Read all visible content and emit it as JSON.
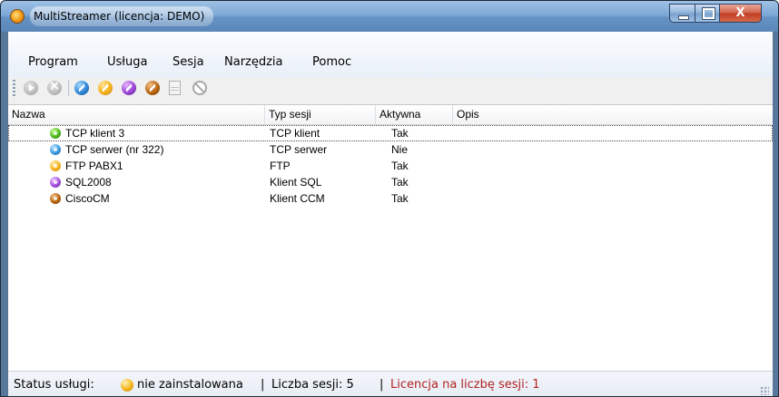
{
  "window": {
    "title": "MultiStreamer (licencja: DEMO)",
    "close_glyph": "X"
  },
  "menu": {
    "items": [
      "Program",
      "Usługa",
      "Sesja",
      "Narzędzia",
      "Pomoc"
    ]
  },
  "toolbar": {
    "icons": [
      "play-icon",
      "stop-icon",
      "blue-session-icon",
      "orange-session-icon",
      "purple-session-icon",
      "brown-session-icon",
      "document-icon",
      "disable-icon"
    ]
  },
  "table": {
    "columns": [
      "Nazwa",
      "Typ sesji",
      "Aktywna",
      "Opis"
    ],
    "rows": [
      {
        "name": "TCP klient 3",
        "type": "TCP klient",
        "active": "Tak",
        "desc": "",
        "icon": "green"
      },
      {
        "name": "TCP serwer (nr 322)",
        "type": "TCP serwer",
        "active": "Nie",
        "desc": "",
        "icon": "blue"
      },
      {
        "name": "FTP PABX1",
        "type": "FTP",
        "active": "Tak",
        "desc": "",
        "icon": "orange"
      },
      {
        "name": "SQL2008",
        "type": "Klient SQL",
        "active": "Tak",
        "desc": "",
        "icon": "purple"
      },
      {
        "name": "CiscoCM",
        "type": "Klient CCM",
        "active": "Tak",
        "desc": "",
        "icon": "brown"
      }
    ]
  },
  "status": {
    "service_label": "Status usługi:",
    "service_value": "nie zainstalowana",
    "sep1": "|",
    "sessions": "Liczba sesji: 5",
    "sep2": "|",
    "license": "Licencja na liczbę sesji: 1",
    "license_color": "#b22222"
  }
}
